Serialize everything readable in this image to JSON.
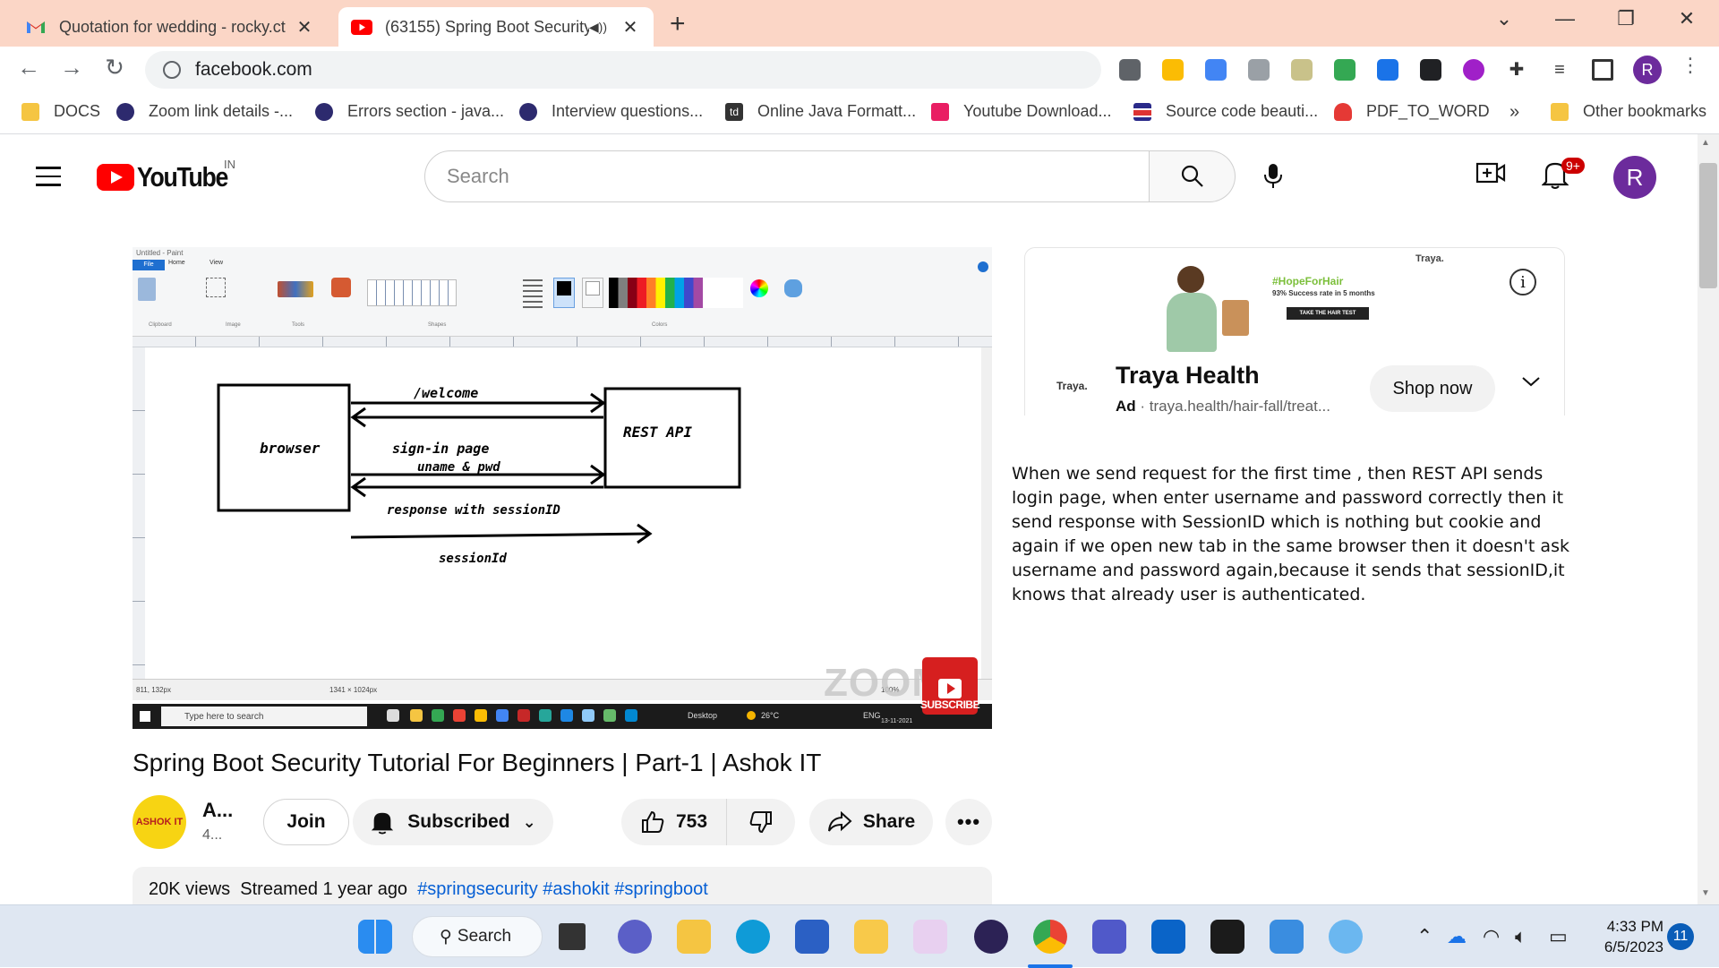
{
  "browser": {
    "tabs": [
      {
        "title": "Quotation for wedding - rocky.ct",
        "icon": "gmail-icon"
      },
      {
        "title": "(63155) Spring Boot Security",
        "icon": "youtube-icon",
        "audio": true
      }
    ],
    "url": "facebook.com",
    "bookmarks": [
      {
        "label": "DOCS"
      },
      {
        "label": "Zoom link details -..."
      },
      {
        "label": "Errors section - java..."
      },
      {
        "label": "Interview questions..."
      },
      {
        "label": "Online Java Formatt..."
      },
      {
        "label": "Youtube Download..."
      },
      {
        "label": "Source code beauti..."
      },
      {
        "label": "PDF_TO_WORD"
      }
    ],
    "bookmarks_overflow": "»",
    "other_bookmarks": "Other bookmarks",
    "profile_initial": "R"
  },
  "youtube": {
    "logo_text": "YouTube",
    "country_code": "IN",
    "search_placeholder": "Search",
    "notification_count": "9+",
    "avatar_initial": "R"
  },
  "video": {
    "paint_title": "Untitled - Paint",
    "paint_tabs": [
      "File",
      "Home",
      "View"
    ],
    "paint_groups": [
      "Clipboard",
      "Image",
      "Tools",
      "Shapes",
      "Colors"
    ],
    "paint_status_pos": "811, 132px",
    "paint_status_size": "1341 × 1024px",
    "paint_zoom": "100%",
    "diagram": {
      "box_browser": "browser",
      "box_api": "REST API",
      "arrow_welcome": "/welcome",
      "arrow_signin": "sign-in page",
      "arrow_uname": "uname & pwd",
      "arrow_response": "response with sessionID",
      "arrow_session": "sessionId"
    },
    "win_search": "Type here to search",
    "win_desktop": "Desktop",
    "win_temp": "26°C",
    "win_lang": "ENG",
    "win_date": "13-11-2021",
    "watermark": "ZOOM",
    "subscribe_badge": "SUBSCRIBE"
  },
  "meta": {
    "title": "Spring Boot Security Tutorial For Beginners | Part-1 | Ashok IT",
    "channel_avatar_text": "ASHOK IT",
    "channel_name": "A...",
    "channel_subs": "4...",
    "join_label": "Join",
    "subscribed_label": "Subscribed",
    "like_count": "753",
    "share_label": "Share",
    "views": "20K views",
    "streamed": "Streamed 1 year ago",
    "tags": "#springsecurity #ashokit #springboot"
  },
  "ad": {
    "brand_small": "Traya.",
    "hashtag": "#HopeForHair",
    "claim": "93% Success rate in 5 months",
    "cta_small": "TAKE THE HAIR TEST",
    "brand": "Traya Health",
    "ad_label": "Ad",
    "url": "traya.health/hair-fall/treat...",
    "shop_label": "Shop now",
    "logo_text": "Traya."
  },
  "note": {
    "text": "When we send request for the first time , then REST API sends login page, when enter username and password correctly then it send response with SessionID which is nothing but cookie and again if we open new tab in the same browser then it doesn't ask username and password again,because it sends that sessionID,it knows that already user is authenticated."
  },
  "taskbar": {
    "search_label": "Search",
    "time": "4:33 PM",
    "date": "6/5/2023",
    "notification_count": "11"
  },
  "colors": {
    "tabstrip": "#fbd6c6",
    "youtube_red": "#ff0000",
    "avatar_purple": "#6c2b9c",
    "link_blue": "#065fd4"
  }
}
